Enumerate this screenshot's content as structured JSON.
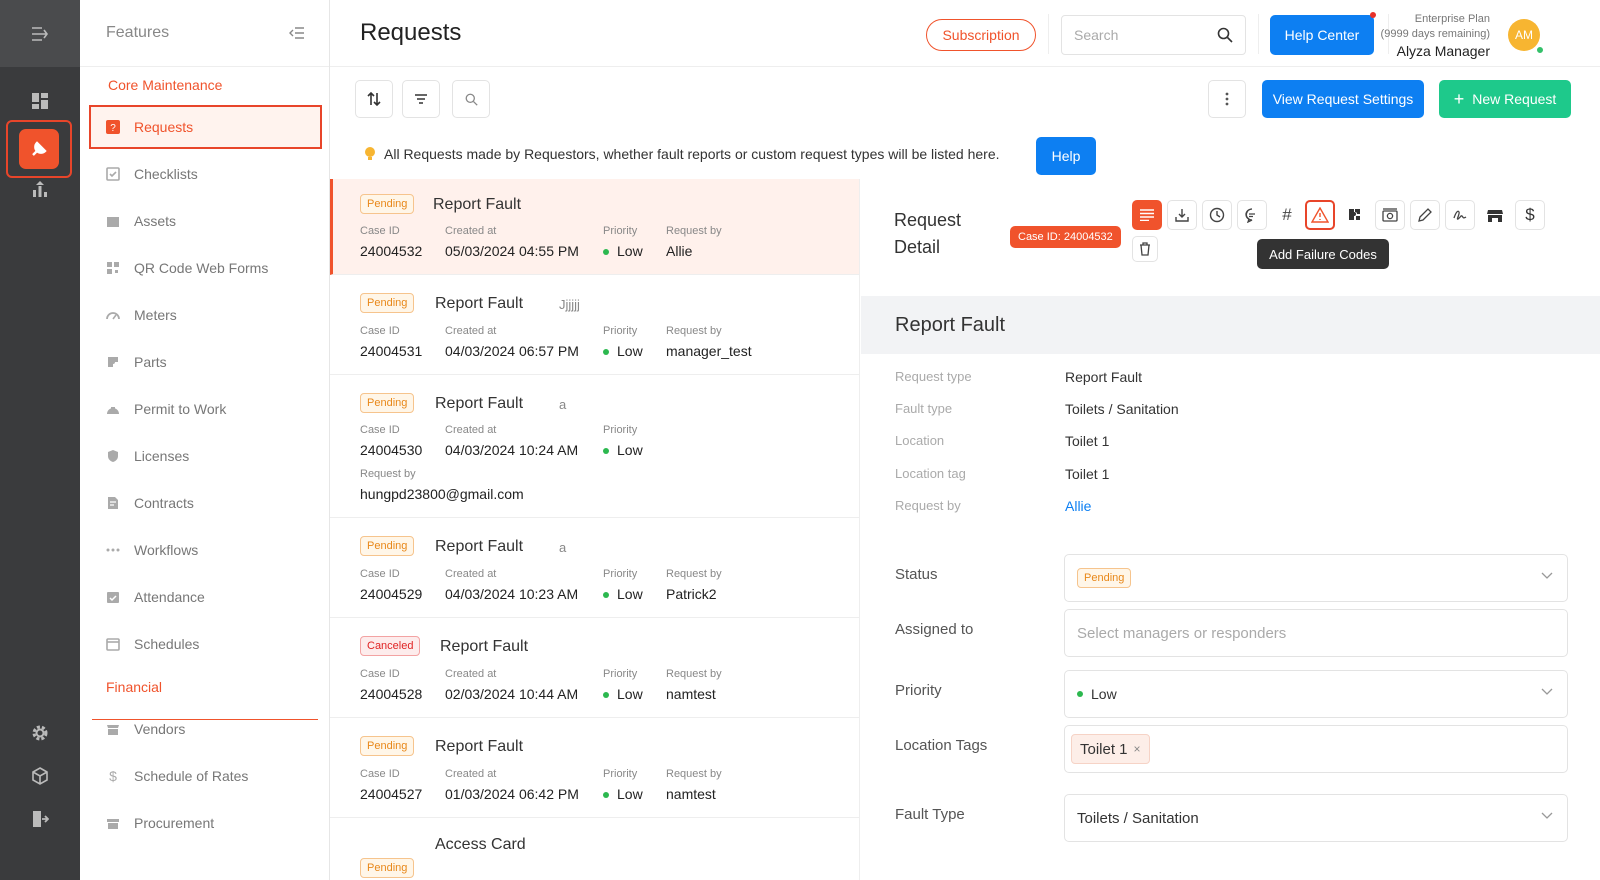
{
  "rail": {
    "icons": [
      "collapse-menu-icon",
      "dashboard-icon",
      "maintenance-icon",
      "analytics-icon",
      "settings-icon",
      "cube-icon",
      "logout-icon"
    ]
  },
  "features": {
    "title": "Features",
    "core_section": "Core Maintenance",
    "financial_section": "Financial",
    "items": [
      {
        "label": "Requests",
        "icon": "requests-icon"
      },
      {
        "label": "Checklists",
        "icon": "checklist-icon"
      },
      {
        "label": "Assets",
        "icon": "assets-icon"
      },
      {
        "label": "QR Code Web Forms",
        "icon": "qr-code-icon"
      },
      {
        "label": "Meters",
        "icon": "meter-icon"
      },
      {
        "label": "Parts",
        "icon": "parts-icon"
      },
      {
        "label": "Permit to Work",
        "icon": "permit-icon"
      },
      {
        "label": "Licenses",
        "icon": "license-icon"
      },
      {
        "label": "Contracts",
        "icon": "contract-icon"
      },
      {
        "label": "Workflows",
        "icon": "workflow-icon"
      },
      {
        "label": "Attendance",
        "icon": "attendance-icon"
      },
      {
        "label": "Schedules",
        "icon": "schedule-icon"
      }
    ],
    "financial_items": [
      {
        "label": "Vendors",
        "icon": "vendor-icon"
      },
      {
        "label": "Schedule of Rates",
        "icon": "dollar-icon"
      },
      {
        "label": "Procurement",
        "icon": "procurement-icon"
      }
    ]
  },
  "header": {
    "title": "Requests",
    "subscription": "Subscription",
    "search_placeholder": "Search",
    "help_center": "Help Center",
    "plan": "Enterprise Plan",
    "plan_remaining": "(9999 days remaining)",
    "user_name": "Alyza Manager",
    "avatar_initials": "AM"
  },
  "toolbar": {
    "view_settings": "View Request Settings",
    "new_request": "New Request",
    "new_request_icon": "+"
  },
  "info": {
    "text": "All Requests made by Requestors, whether fault reports or custom request types will be listed here.",
    "help": "Help"
  },
  "labels": {
    "case_id": "Case ID",
    "created_at": "Created at",
    "priority": "Priority",
    "request_by": "Request by"
  },
  "requests": [
    {
      "status": "Pending",
      "title": "Report Fault",
      "extra": "",
      "case_id": "24004532",
      "created": "05/03/2024 04:55 PM",
      "priority": "Low",
      "by": "Allie"
    },
    {
      "status": "Pending",
      "title": "Report Fault",
      "extra": "Jjjjjj",
      "case_id": "24004531",
      "created": "04/03/2024 06:57 PM",
      "priority": "Low",
      "by": "manager_test"
    },
    {
      "status": "Pending",
      "title": "Report Fault",
      "extra": "a",
      "case_id": "24004530",
      "created": "04/03/2024 10:24 AM",
      "priority": "Low",
      "by": "hungpd23800@gmail.com"
    },
    {
      "status": "Pending",
      "title": "Report Fault",
      "extra": "a",
      "case_id": "24004529",
      "created": "04/03/2024 10:23 AM",
      "priority": "Low",
      "by": "Patrick2"
    },
    {
      "status": "Canceled",
      "title": "Report Fault",
      "extra": "",
      "case_id": "24004528",
      "created": "02/03/2024 10:44 AM",
      "priority": "Low",
      "by": "namtest"
    },
    {
      "status": "Pending",
      "title": "Report Fault",
      "extra": "",
      "case_id": "24004527",
      "created": "01/03/2024 06:42 PM",
      "priority": "Low",
      "by": "namtest"
    },
    {
      "status": "Pending",
      "title": "Access Card"
    }
  ],
  "detail": {
    "title_line1": "Request",
    "title_line2": "Detail",
    "case_badge": "Case ID: 24004532",
    "tooltip": "Add Failure Codes",
    "section_title": "Report Fault",
    "fields": [
      {
        "label": "Request type",
        "value": "Report Fault"
      },
      {
        "label": "Fault type",
        "value": "Toilets / Sanitation"
      },
      {
        "label": "Location",
        "value": "Toilet 1"
      },
      {
        "label": "Location tag",
        "value": "Toilet 1"
      },
      {
        "label": "Request by",
        "value": "Allie"
      }
    ],
    "form": {
      "status_label": "Status",
      "status_value": "Pending",
      "assigned_label": "Assigned to",
      "assigned_placeholder": "Select managers or responders",
      "priority_label": "Priority",
      "priority_value": "Low",
      "location_tags_label": "Location Tags",
      "location_tag": "Toilet 1",
      "fault_type_label": "Fault Type",
      "fault_type_value": "Toilets / Sanitation"
    }
  },
  "colors": {
    "accent": "#f0532c",
    "primary": "#0d7ff2",
    "success": "#1ec98b"
  }
}
